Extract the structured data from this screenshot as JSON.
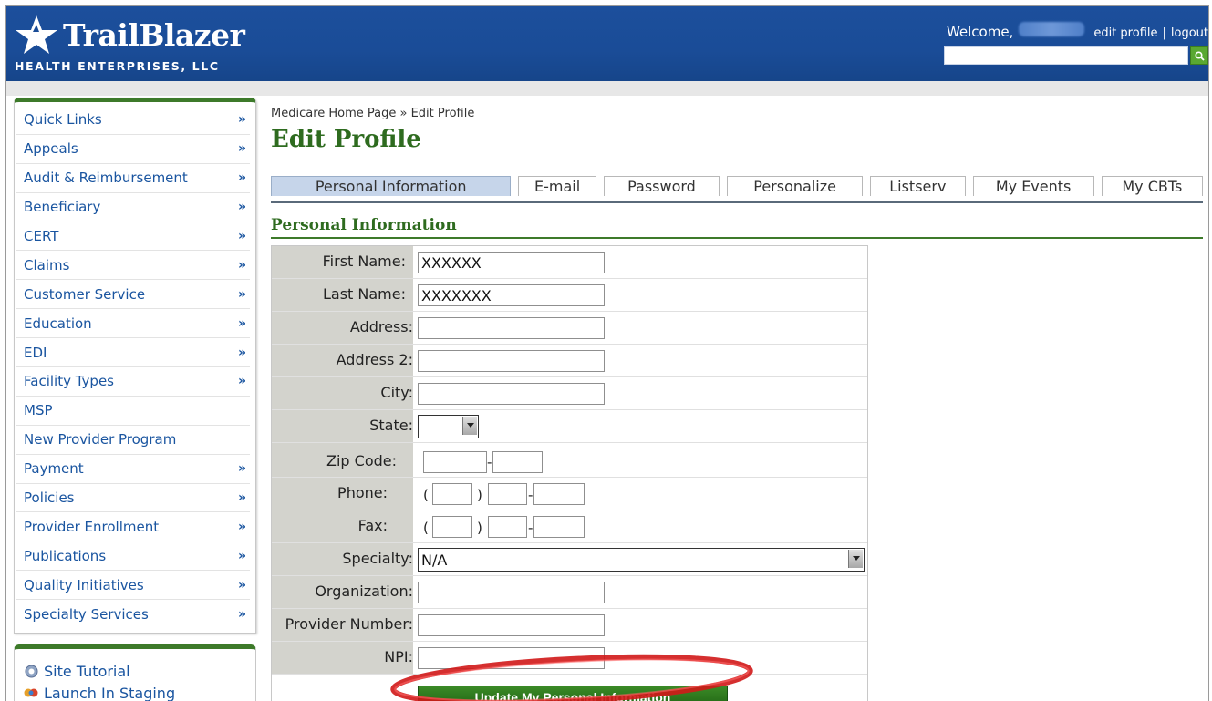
{
  "header": {
    "logo_name": "TrailBlazer",
    "logo_sub": "HEALTH ENTERPRISES, LLC",
    "welcome": "Welcome,",
    "edit_profile": "edit profile",
    "separator": "|",
    "logout": "logout",
    "search_placeholder": ""
  },
  "sidebar": {
    "items": [
      {
        "label": "Quick Links",
        "arrow": "»"
      },
      {
        "label": "Appeals",
        "arrow": "»"
      },
      {
        "label": "Audit & Reimbursement",
        "arrow": "»"
      },
      {
        "label": "Beneficiary",
        "arrow": "»"
      },
      {
        "label": "CERT",
        "arrow": "»"
      },
      {
        "label": "Claims",
        "arrow": "»"
      },
      {
        "label": "Customer Service",
        "arrow": "»"
      },
      {
        "label": "Education",
        "arrow": "»"
      },
      {
        "label": "EDI",
        "arrow": "»"
      },
      {
        "label": "Facility Types",
        "arrow": "»"
      },
      {
        "label": "MSP",
        "arrow": ""
      },
      {
        "label": "New Provider Program",
        "arrow": ""
      },
      {
        "label": "Payment",
        "arrow": "»"
      },
      {
        "label": "Policies",
        "arrow": "»"
      },
      {
        "label": "Provider Enrollment",
        "arrow": "»"
      },
      {
        "label": "Publications",
        "arrow": "»"
      },
      {
        "label": "Quality Initiatives",
        "arrow": "»"
      },
      {
        "label": "Specialty Services",
        "arrow": "»"
      }
    ],
    "tools": {
      "tutorial": "Site Tutorial",
      "staging": "Launch In Staging"
    }
  },
  "main": {
    "breadcrumb": "Medicare Home Page » Edit Profile",
    "title": "Edit Profile",
    "tabs": [
      {
        "label": "Personal Information",
        "active": true
      },
      {
        "label": "E-mail",
        "active": false
      },
      {
        "label": "Password",
        "active": false
      },
      {
        "label": "Personalize",
        "active": false
      },
      {
        "label": "Listserv",
        "active": false
      },
      {
        "label": "My Events",
        "active": false
      },
      {
        "label": "My CBTs",
        "active": false
      }
    ],
    "section_title": "Personal Information"
  },
  "form": {
    "first_name_label": "First Name:",
    "first_name_value": "XXXXXX",
    "last_name_label": "Last Name:",
    "last_name_value": "XXXXXXX",
    "address_label": "Address:",
    "address2_label": "Address 2:",
    "city_label": "City:",
    "state_label": "State:",
    "state_value": "",
    "zip_label": "Zip Code:",
    "zip_dash": "-",
    "phone_label": "Phone:",
    "fax_label": "Fax:",
    "open_paren": "(",
    "close_paren": ")",
    "dash": "-",
    "specialty_label": "Specialty:",
    "specialty_value": "N/A",
    "organization_label": "Organization:",
    "provider_number_label": "Provider Number:",
    "npi_label": "NPI:",
    "submit_label": "Update My Personal Information"
  },
  "colors": {
    "header_blue": "#1a4c97",
    "brand_green": "#2e6b1f",
    "link_blue": "#1a55a0",
    "highlight_red": "#d01818"
  }
}
